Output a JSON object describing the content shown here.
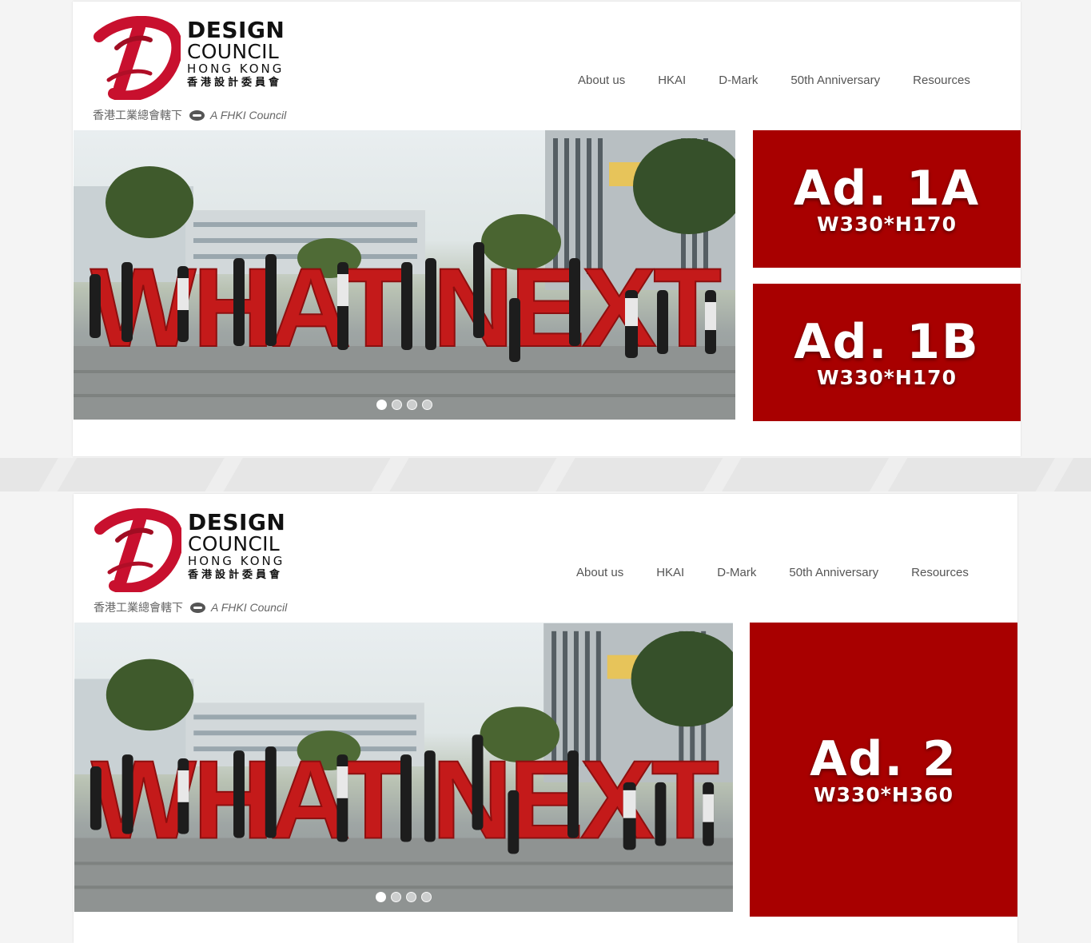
{
  "brand": {
    "line1": "DESIGN",
    "line2": "COUNCIL",
    "line3": "HONG KONG",
    "line4": "香港設計委員會",
    "tagline_zh": "香港工業總會轄下",
    "tagline_en": "A FHKI Council"
  },
  "nav": {
    "items": [
      "About us",
      "HKAI",
      "D-Mark",
      "50th Anniversary",
      "Resources"
    ]
  },
  "hero": {
    "sign_text": "WHAT NEXT",
    "slides_total": 4,
    "slide_active": 1
  },
  "variant1": {
    "ads": [
      {
        "name": "Ad. 1A",
        "size": "W330*H170"
      },
      {
        "name": "Ad. 1B",
        "size": "W330*H170"
      }
    ]
  },
  "variant2": {
    "ads": [
      {
        "name": "Ad. 2",
        "size": "W330*H360"
      }
    ]
  },
  "colors": {
    "brand_red": "#c8102e",
    "ad_red": "#a80000",
    "nav_text": "#555555"
  }
}
